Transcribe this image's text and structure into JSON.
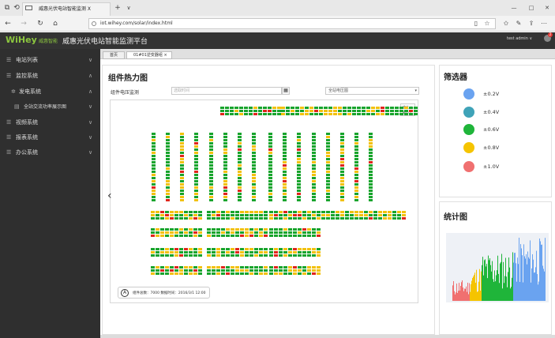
{
  "browser": {
    "tab_title": "威惠光伏电站智能监测 X",
    "new_tab": "+",
    "tab_menu": "∨",
    "url": "iot.wihey.com/solar/index.html",
    "win_min": "—",
    "win_max": "□",
    "win_close": "✕"
  },
  "header": {
    "logo_text": "WiHey",
    "brand_small": "威惠智能",
    "title": "威惠光伏电站智能监测平台",
    "user": "test  admin ∨",
    "badge": "2"
  },
  "sidebar": {
    "items": [
      {
        "label": "电站列表",
        "arrow": "∨"
      },
      {
        "label": "监控系统",
        "arrow": "∧"
      },
      {
        "label": "发电系统",
        "arrow": "∧"
      },
      {
        "label": "全站交流功率展示图",
        "arrow": "∨"
      },
      {
        "label": "视频系统",
        "arrow": "∨"
      },
      {
        "label": "报表系统",
        "arrow": "∨"
      },
      {
        "label": "办公系统",
        "arrow": "∨"
      }
    ]
  },
  "content_tabs": [
    {
      "label": "首页"
    },
    {
      "label": "01#01逆变器组 ×"
    }
  ],
  "heatmap": {
    "title": "组件热力图",
    "control_label": "组件电压监测",
    "date_placeholder": "选取时间",
    "cal_icon": "▦",
    "select_value": "全站电压图",
    "zoom_in": "放大 +",
    "zoom_out": "缩小 -",
    "info_icon": "A",
    "info_text": "组件总数：7000    数据时间：2016/3/1 12:00"
  },
  "filter": {
    "title": "筛选器",
    "items": [
      {
        "label": "±0.2V",
        "color": "#6aa3f0"
      },
      {
        "label": "±0.4V",
        "color": "#3fa3b8"
      },
      {
        "label": "±0.6V",
        "color": "#1fb53a"
      },
      {
        "label": "±0.8V",
        "color": "#f5c400"
      },
      {
        "label": "±1.0V",
        "color": "#f07070"
      }
    ]
  },
  "stats": {
    "title": "统计图"
  },
  "colors": {
    "green": "#18a42c",
    "yellow": "#f2c10c",
    "red": "#e0251b",
    "sidebar": "#2f2f2f",
    "header": "#333333"
  }
}
